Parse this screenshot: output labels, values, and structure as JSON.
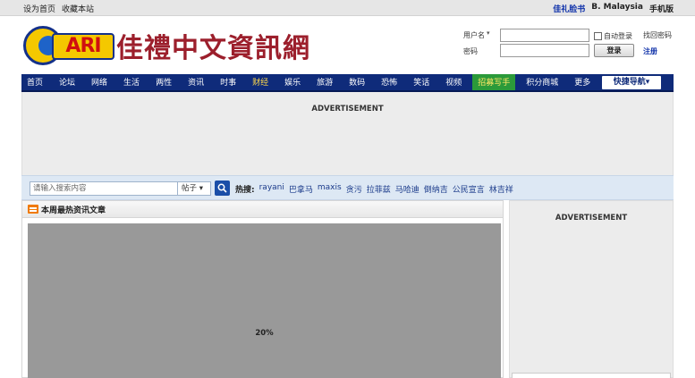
{
  "topbar": {
    "left": [
      "设为首页",
      "收藏本站"
    ],
    "right": {
      "brand_link": "佳礼脸书",
      "region": "B. Malaysia",
      "mobile": "手机版"
    }
  },
  "logo": {
    "mark_text": "ARI",
    "chinese_name": "佳禮中文資訊網"
  },
  "login": {
    "username_label": "用户名",
    "password_label": "密码",
    "auto_login": "自动登录",
    "forgot_password": "找回密码",
    "login_button": "登录",
    "register": "注册"
  },
  "nav": {
    "items": [
      {
        "label": "首页"
      },
      {
        "label": "论坛"
      },
      {
        "label": "网络"
      },
      {
        "label": "生活"
      },
      {
        "label": "两性"
      },
      {
        "label": "资讯"
      },
      {
        "label": "时事"
      },
      {
        "label": "财经"
      },
      {
        "label": "娱乐"
      },
      {
        "label": "旅游"
      },
      {
        "label": "数码"
      },
      {
        "label": "恐怖"
      },
      {
        "label": "笑话"
      },
      {
        "label": "视频"
      },
      {
        "label": "招募写手"
      },
      {
        "label": "积分商城"
      },
      {
        "label": "更多"
      }
    ],
    "quick_nav": "快捷导航"
  },
  "ads": {
    "top": "ADVERTISEMENT",
    "side": "ADVERTISEMENT"
  },
  "search": {
    "placeholder": "请输入搜索内容",
    "type": "帖子",
    "hot_label": "热搜:",
    "hot_tags": [
      "rayani",
      "巴拿马",
      "maxis",
      "贪污",
      "拉菲兹",
      "马哈迪",
      "倒纳吉",
      "公民宣言",
      "林吉祥"
    ]
  },
  "main": {
    "section_title": "本周最热资讯文章",
    "loading_percent": "20%"
  },
  "colors": {
    "nav_bg": "#0f2b7a",
    "accent_yellow": "#ffd84a",
    "highlight_green": "#2b9a3a",
    "link_blue": "#1133aa"
  }
}
